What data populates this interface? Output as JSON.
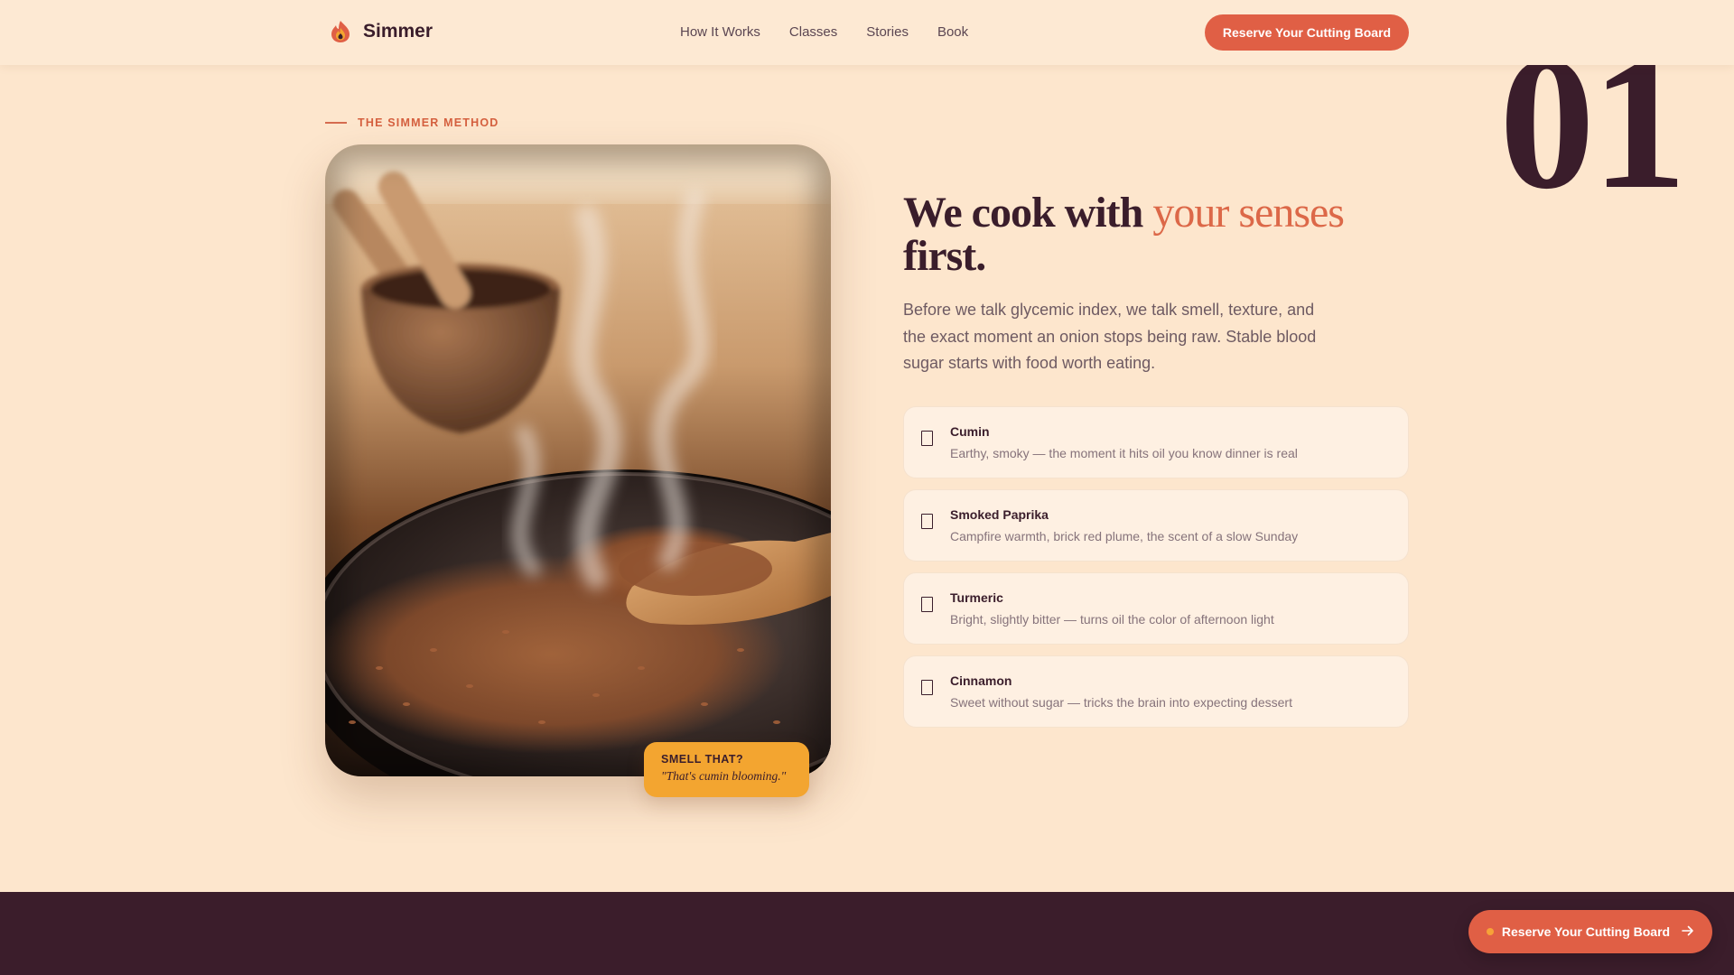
{
  "header": {
    "brand": "Simmer",
    "logo_icon": "flame-icon",
    "nav": [
      "How It Works",
      "Classes",
      "Stories",
      "Book"
    ],
    "cta_label": "Reserve Your Cutting Board"
  },
  "section": {
    "number": "01",
    "eyebrow": "THE SIMMER METHOD",
    "headline_part1": "We cook with ",
    "headline_accent": "your senses",
    "headline_part2": "first.",
    "body": "Before we talk glycemic index, we talk smell, texture, and the exact moment an onion stops being raw. Stable blood sugar starts with food worth eating.",
    "badge_label": "SMELL THAT?",
    "badge_quote": "\"That's cumin blooming.\"",
    "spices": [
      {
        "name": "Cumin",
        "desc": "Earthy, smoky — the moment it hits oil you know dinner is real",
        "checked": false
      },
      {
        "name": "Smoked Paprika",
        "desc": "Campfire warmth, brick red plume, the scent of a slow Sunday",
        "checked": false
      },
      {
        "name": "Turmeric",
        "desc": "Bright, slightly bitter — turns oil the color of afternoon light",
        "checked": false
      },
      {
        "name": "Cinnamon",
        "desc": "Sweet without sugar — tricks the brain into expecting dessert",
        "checked": false
      }
    ]
  },
  "floating_cta": {
    "label": "Reserve Your Cutting Board",
    "icon": "arrow-right-icon"
  },
  "colors": {
    "background": "#fde6cd",
    "accent": "#e05f45",
    "ink": "#3a1d2b",
    "badge": "#f3a530",
    "footer": "#3b1d2b"
  }
}
